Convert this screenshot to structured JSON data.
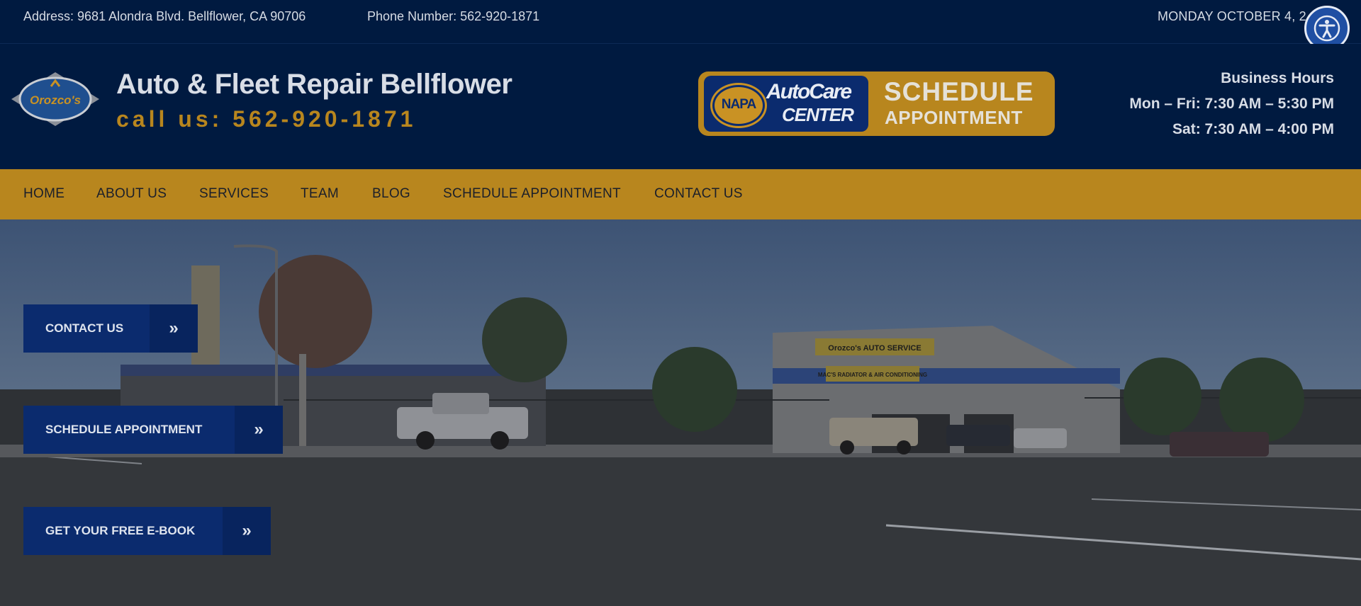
{
  "topbar": {
    "address": "Address: 9681 Alondra Blvd. Bellflower, CA 90706",
    "phone": "Phone Number: 562-920-1871",
    "date": "MONDAY OCTOBER 4, 2"
  },
  "header": {
    "logo_text": "Orozco's",
    "site_title": "Auto & Fleet Repair Bellflower",
    "call_us": "call us: 562-920-1871",
    "napa": {
      "badge_napa": "NAPA",
      "badge_autocare": "AutoCare",
      "badge_center": "CENTER",
      "schedule": "SCHEDULE",
      "appointment": "APPOINTMENT"
    },
    "hours": {
      "title": "Business Hours",
      "weekdays": "Mon – Fri: 7:30 AM – 5:30 PM",
      "saturday": "Sat: 7:30 AM – 4:00 PM"
    }
  },
  "nav": {
    "items": [
      "HOME",
      "ABOUT US",
      "SERVICES",
      "TEAM",
      "BLOG",
      "SCHEDULE APPOINTMENT",
      "CONTACT US"
    ]
  },
  "hero": {
    "buttons": [
      {
        "label": "CONTACT US",
        "icon": "double-chevron-right-icon"
      },
      {
        "label": "SCHEDULE APPOINTMENT",
        "icon": "double-chevron-right-icon"
      },
      {
        "label": "GET YOUR FREE E-BOOK",
        "icon": "double-chevron-right-icon"
      }
    ],
    "sign_shop": "Orozco's AUTO SERVICE",
    "sign_radiator": "MAC'S RADIATOR & AIR CONDITIONING"
  },
  "colors": {
    "navy": "#001a40",
    "gold": "#b8861e",
    "button_blue": "#0b2b6e"
  }
}
